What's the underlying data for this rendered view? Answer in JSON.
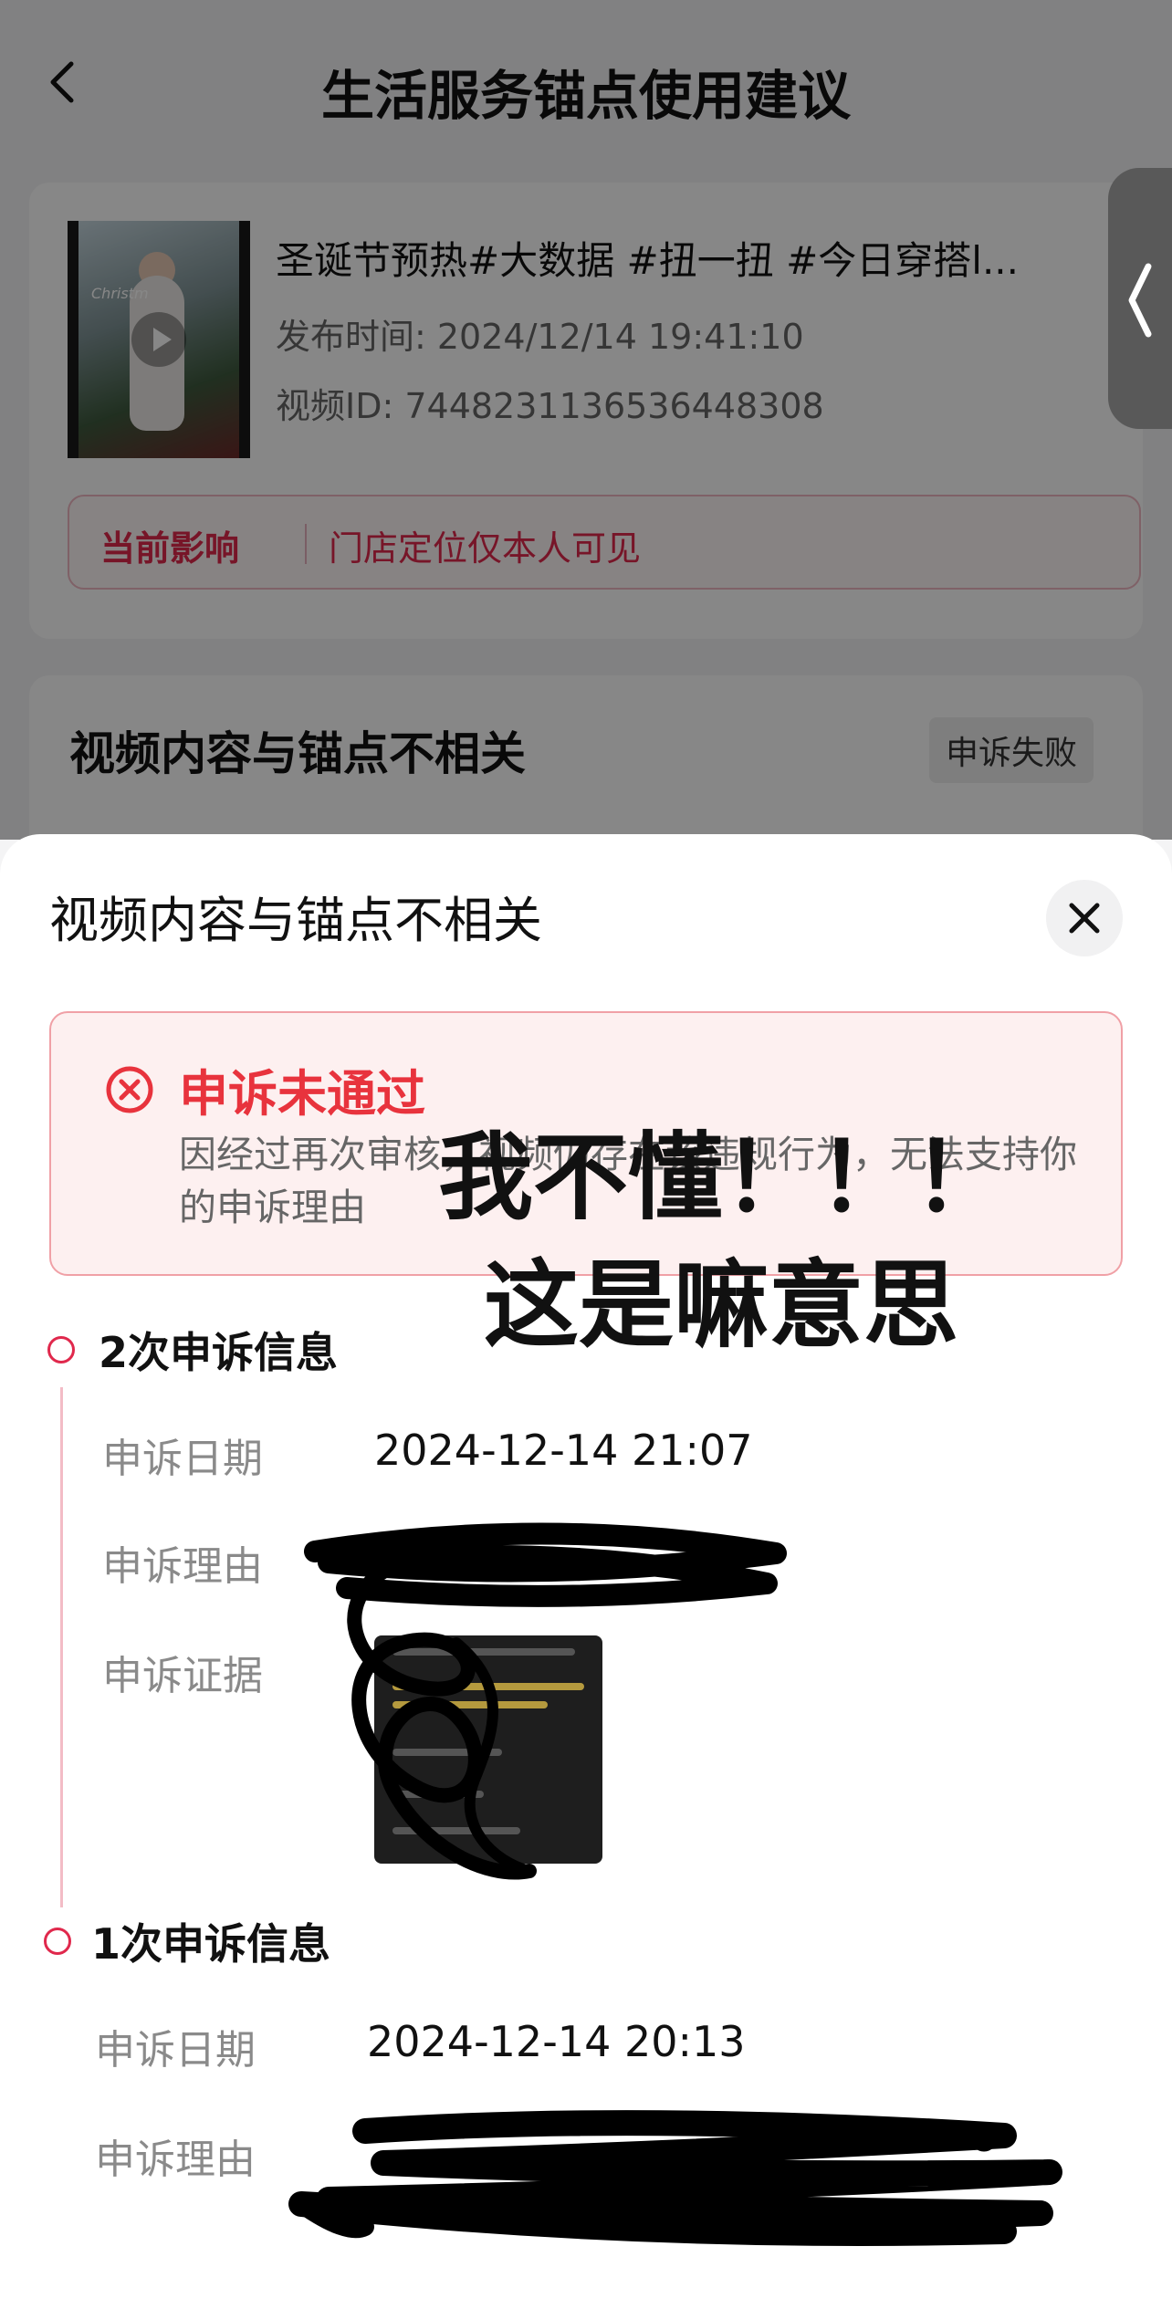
{
  "nav": {
    "title": "生活服务锚点使用建议"
  },
  "video": {
    "title": "圣诞节预热#大数据 #扭一扭 #今日穿搭l...",
    "publish_time": "发布时间: 2024/12/14 19:41:10",
    "video_id": "视频ID: 7448231136536448308",
    "thumb_text": "Christm"
  },
  "impact": {
    "label": "当前影响",
    "value": "门店定位仅本人可见"
  },
  "reason_card": {
    "title": "视频内容与锚点不相关",
    "status": "申诉失败"
  },
  "sheet": {
    "title": "视频内容与锚点不相关",
    "fail": {
      "title": "申诉未通过",
      "desc": "因经过再次审核，视频仍存在该违规行为，无法支持你的申诉理由"
    },
    "overlay": {
      "line1": "我不懂！！！",
      "line2": "这是嘛意思"
    },
    "appeals": [
      {
        "heading": "2次申诉信息",
        "date_label": "申诉日期",
        "date": "2024-12-14 21:07",
        "reason_label": "申诉理由",
        "evidence_label": "申诉证据"
      },
      {
        "heading": "1次申诉信息",
        "date_label": "申诉日期",
        "date": "2024-12-14 20:13",
        "reason_label": "申诉理由"
      }
    ]
  },
  "colors": {
    "accent": "#e0284c",
    "fail_red": "#e8333d",
    "fail_bg": "#fdf0f0"
  }
}
